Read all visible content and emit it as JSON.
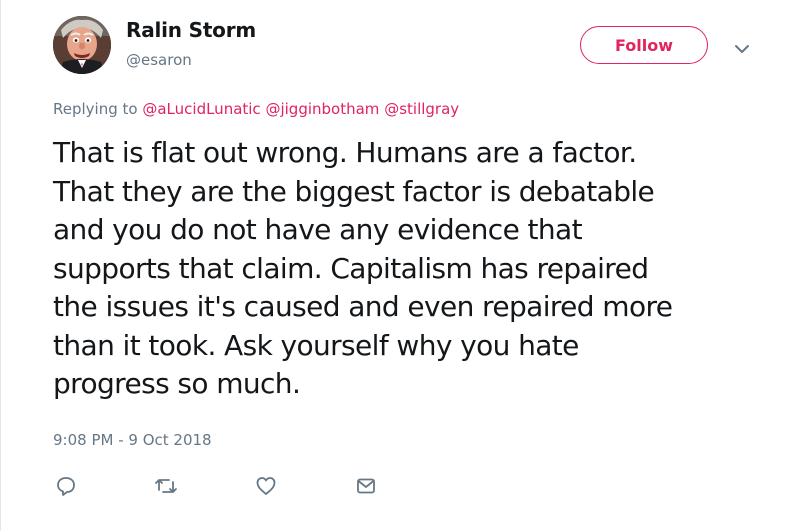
{
  "author": {
    "display_name": "Ralin Storm",
    "handle": "@esaron",
    "avatar_icon": "ventriloquist-puppet-avatar"
  },
  "follow": {
    "label": "Follow",
    "color": "#e0245e"
  },
  "menu": {
    "icon": "chevron-down-icon"
  },
  "reply": {
    "prefix": "Replying to",
    "mentions": [
      "@aLucidLunatic",
      "@jigginbotham",
      "@stillgray"
    ]
  },
  "tweet": {
    "text": "That is flat out wrong. Humans are a factor.\nThat they are the biggest factor is debatable\nand you do not have any evidence that\nsupports that claim. Capitalism has repaired\nthe issues it's caused and even repaired more\nthan it took. Ask yourself why you hate\nprogress so much.",
    "timestamp": "9:08 PM - 9 Oct 2018"
  },
  "actions": [
    {
      "icon": "reply-icon"
    },
    {
      "icon": "retweet-icon"
    },
    {
      "icon": "like-icon"
    },
    {
      "icon": "direct-message-icon"
    }
  ],
  "colors": {
    "accent": "#e0245e",
    "secondary_text": "#657786",
    "primary_text": "#14171a"
  }
}
